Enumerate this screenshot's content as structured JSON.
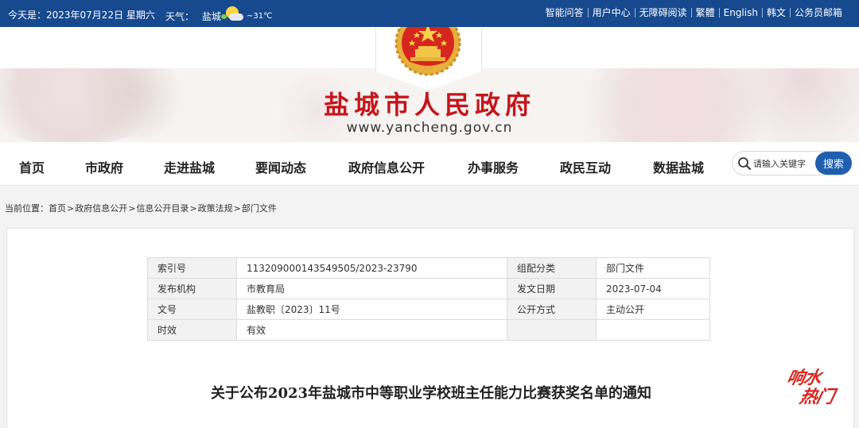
{
  "topbar": {
    "date_text": "今天是：2023年07月22日 星期六",
    "weather_label": "天气：",
    "weather_city": "盐城",
    "weather_temp": "~31℃",
    "links": [
      "智能问答",
      "用户中心",
      "无障碍阅读",
      "繁體",
      "English",
      "韩文",
      "公务员邮箱"
    ]
  },
  "header": {
    "site_title": "盐城市人民政府",
    "site_url": "www.yancheng.gov.cn"
  },
  "nav": {
    "items": [
      "首页",
      "市政府",
      "走进盐城",
      "要闻动态",
      "政府信息公开",
      "办事服务",
      "政民互动",
      "数据盐城"
    ],
    "search_placeholder": "请输入关键字",
    "search_button": "搜索"
  },
  "breadcrumb": {
    "label": "当前位置：",
    "items": [
      "首页",
      "政府信息公开",
      "信息公开目录",
      "政策法规",
      "部门文件"
    ]
  },
  "doc_meta": {
    "rows": [
      {
        "k1": "索引号",
        "v1": "113209000143549505/2023-23790",
        "k2": "组配分类",
        "v2": "部门文件"
      },
      {
        "k1": "发布机构",
        "v1": "市教育局",
        "k2": "发文日期",
        "v2": "2023-07-04"
      },
      {
        "k1": "文号",
        "v1": "盐教职〔2023〕11号",
        "k2": "公开方式",
        "v2": "主动公开"
      },
      {
        "k1": "时效",
        "v1": "有效",
        "k2": "",
        "v2": ""
      }
    ]
  },
  "document": {
    "title": "关于公布2023年盐城市中等职业学校班主任能力比赛获奖名单的通知"
  },
  "watermark": {
    "line1": "响水",
    "line2": "热门"
  }
}
